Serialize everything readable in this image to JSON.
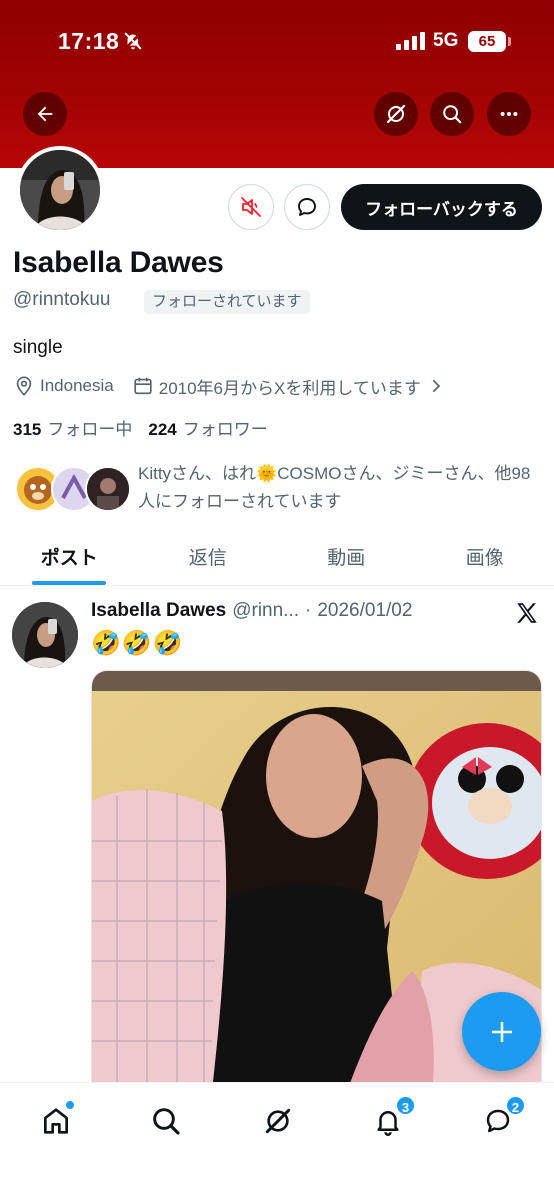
{
  "status_bar": {
    "time": "17:18",
    "network": "5G",
    "battery": "65"
  },
  "header": {
    "icons": [
      "back-arrow-icon",
      "grok-icon",
      "search-icon",
      "more-icon"
    ]
  },
  "profile": {
    "name": "Isabella Dawes",
    "handle": "@rinntokuu",
    "follows_you_label": "フォローされています",
    "follow_back_label": "フォローバックする",
    "bio": "single",
    "location": "Indonesia",
    "joined": "2010年6月からXを利用しています",
    "following_count": "315",
    "following_label": "フォロー中",
    "followers_count": "224",
    "followers_label": "フォロワー",
    "followed_by_text": "Kittyさん、はれ🌞COSMOさん、ジミーさん、他98人にフォローされています"
  },
  "tabs": [
    {
      "label": "ポスト",
      "active": true
    },
    {
      "label": "返信",
      "active": false
    },
    {
      "label": "動画",
      "active": false
    },
    {
      "label": "画像",
      "active": false
    }
  ],
  "post": {
    "author_name": "Isabella Dawes",
    "author_handle": "@rinn...",
    "separator": "·",
    "date": "2026/01/02",
    "text": "🤣🤣🤣"
  },
  "bottom_nav": {
    "notifications_badge": "3",
    "messages_badge": "2"
  },
  "colors": {
    "header_red": "#a30303",
    "accent_blue": "#1d9bf0",
    "follow_button": "#0f1419"
  }
}
